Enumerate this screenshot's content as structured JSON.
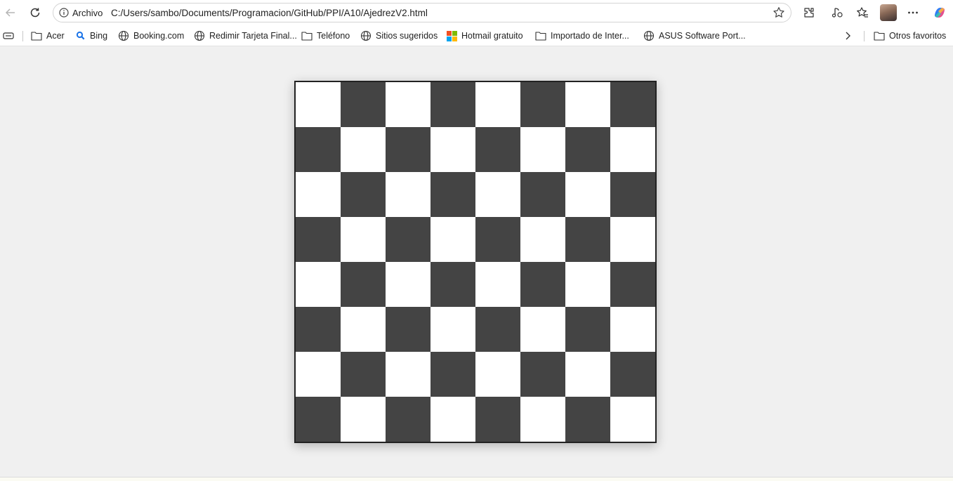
{
  "address_bar": {
    "scheme_label": "Archivo",
    "url": "C:/Users/sambo/Documents/Programacion/GitHub/PPI/A10/AjedrezV2.html"
  },
  "toolbar_icons": [
    "back-arrow-icon",
    "refresh-icon",
    "info-icon",
    "star-icon",
    "extensions-icon",
    "browser-essentials-icon",
    "favorites-icon",
    "profile-avatar",
    "more-options-icon",
    "copilot-icon"
  ],
  "bookmarks": {
    "items": [
      {
        "label": "Acer",
        "icon": "folder-icon"
      },
      {
        "label": "Bing",
        "icon": "search-icon"
      },
      {
        "label": "Booking.com",
        "icon": "globe-icon"
      },
      {
        "label": "Redimir Tarjeta Final...",
        "icon": "globe-icon"
      },
      {
        "label": "Teléfono",
        "icon": "folder-icon"
      },
      {
        "label": "Sitios sugeridos",
        "icon": "globe-icon"
      },
      {
        "label": "Hotmail gratuito",
        "icon": "microsoft-logo-icon"
      },
      {
        "label": "Importado de Inter...",
        "icon": "folder-icon"
      },
      {
        "label": "ASUS Software Port...",
        "icon": "globe-icon"
      }
    ],
    "other_favorites": "Otros favoritos"
  },
  "board": {
    "rows": 8,
    "cols": 8,
    "light_color": "#ffffff",
    "dark_color": "#444444",
    "top_left_square": "light"
  }
}
